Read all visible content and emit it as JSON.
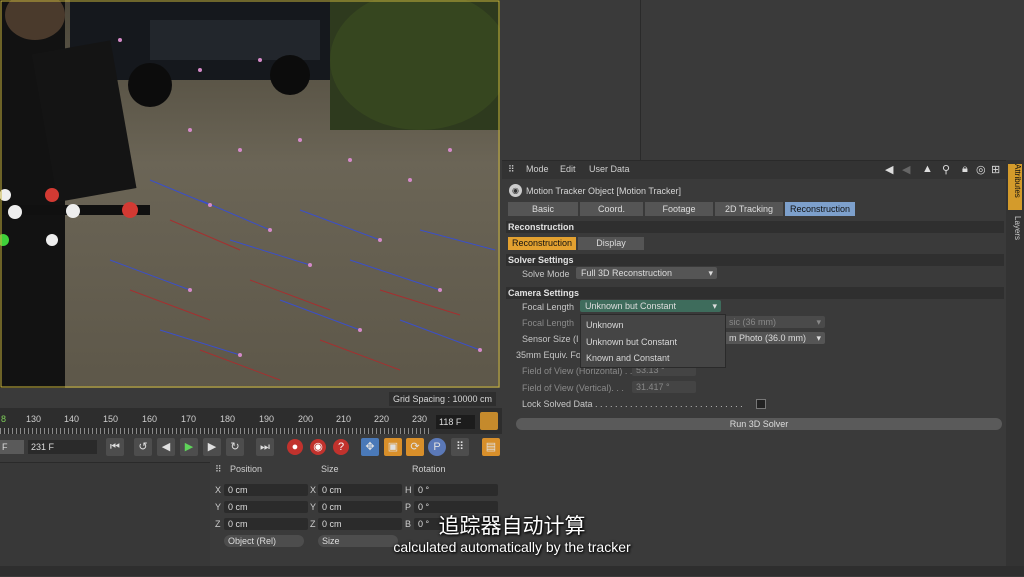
{
  "viewport": {
    "grid_spacing": "Grid Spacing : 10000 cm"
  },
  "timeline": {
    "ticks": [
      "8",
      "130",
      "140",
      "150",
      "160",
      "170",
      "180",
      "190",
      "200",
      "210",
      "220",
      "230"
    ],
    "current_frame": "118 F"
  },
  "transport": {
    "start_field": "F",
    "end_frame": "231 F",
    "record_label": "P"
  },
  "coords": {
    "headers": [
      "Position",
      "Size",
      "Rotation"
    ],
    "rows": [
      {
        "axis": "X",
        "pos": "0 cm",
        "size_axis": "X",
        "size": "0 cm",
        "rot_axis": "H",
        "rot": "0 °"
      },
      {
        "axis": "Y",
        "pos": "0 cm",
        "size_axis": "Y",
        "size": "0 cm",
        "rot_axis": "P",
        "rot": "0 °"
      },
      {
        "axis": "Z",
        "pos": "0 cm",
        "size_axis": "Z",
        "size": "0 cm",
        "rot_axis": "B",
        "rot": "0 °"
      }
    ],
    "mode_dropdown": "Object (Rel)",
    "size_dropdown": "Size"
  },
  "attributes": {
    "menu": [
      "Mode",
      "Edit",
      "User Data"
    ],
    "object_title": "Motion Tracker Object [Motion Tracker]",
    "tabs": [
      "Basic",
      "Coord.",
      "Footage",
      "2D Tracking",
      "Reconstruction"
    ],
    "section_reconstruction": "Reconstruction",
    "subtabs": [
      "Reconstruction",
      "Display"
    ],
    "section_solver": "Solver Settings",
    "solve_mode_label": "Solve Mode",
    "solve_mode_value": "Full 3D Reconstruction",
    "section_camera": "Camera Settings",
    "focal_length_label": "Focal Length",
    "focal_length_value": "Unknown but Constant",
    "focal_length_sub_label": "Focal Length",
    "focal_length_sub_value": "sic (36 mm)",
    "sensor_label": "Sensor Size (I",
    "sensor_value": "m Photo (36.0 mm)",
    "equiv_label": "35mm Equiv. Fo",
    "fov_h_label": "Field of View (Horizontal) . .",
    "fov_h_value": "53.13 °",
    "fov_v_label": "Field of View (Vertical). . .",
    "fov_v_value": "31.417 °",
    "lock_label": "Lock Solved Data . . . . . . . . . . . . . . . . . . . . . . . . . . . . . .",
    "popup_options": [
      "Unknown",
      "Unknown but Constant",
      "Known and Constant"
    ],
    "run_button": "Run 3D Solver",
    "side_tabs": [
      "Attributes",
      "Layers"
    ]
  },
  "subtitles": {
    "chinese": "追踪器自动计算",
    "english": "calculated automatically by the tracker"
  }
}
